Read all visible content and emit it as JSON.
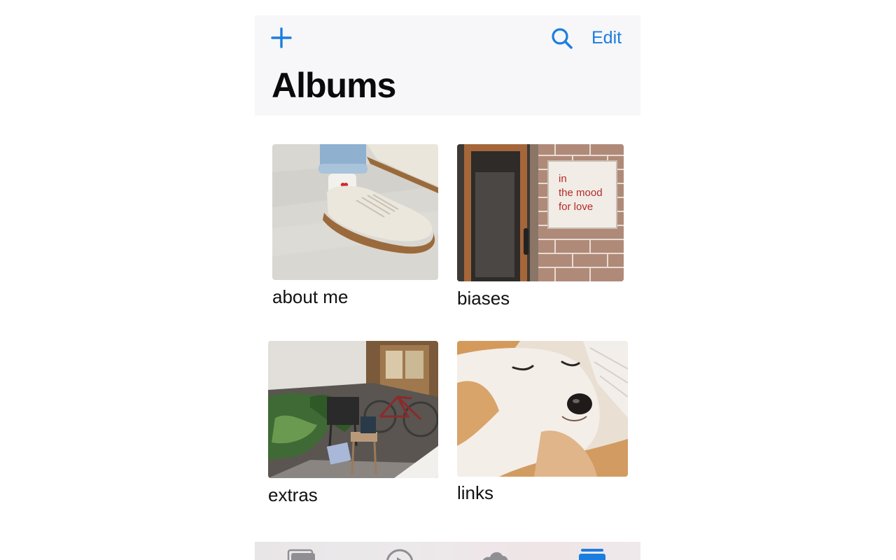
{
  "header": {
    "title": "Albums",
    "edit_label": "Edit",
    "add_icon": "plus-icon",
    "search_icon": "search-icon"
  },
  "albums": [
    {
      "name": "about me",
      "image": "sneaker-photo"
    },
    {
      "name": "biases",
      "image": "door-with-sign-photo",
      "sign_text": [
        "in",
        "the mood",
        "for love"
      ]
    },
    {
      "name": "extras",
      "image": "bicycle-garden-photo"
    },
    {
      "name": "links",
      "image": "shiba-dog-photo"
    }
  ],
  "tab_bar": {
    "tabs": [
      {
        "icon": "photos-tab-icon"
      },
      {
        "icon": "for-you-tab-icon"
      },
      {
        "icon": "shared-tab-icon"
      },
      {
        "icon": "albums-tab-icon",
        "active": true
      }
    ]
  },
  "colors": {
    "accent": "#1a7ee0",
    "header_bg": "#f7f6f8",
    "title": "#0a0a0a"
  }
}
